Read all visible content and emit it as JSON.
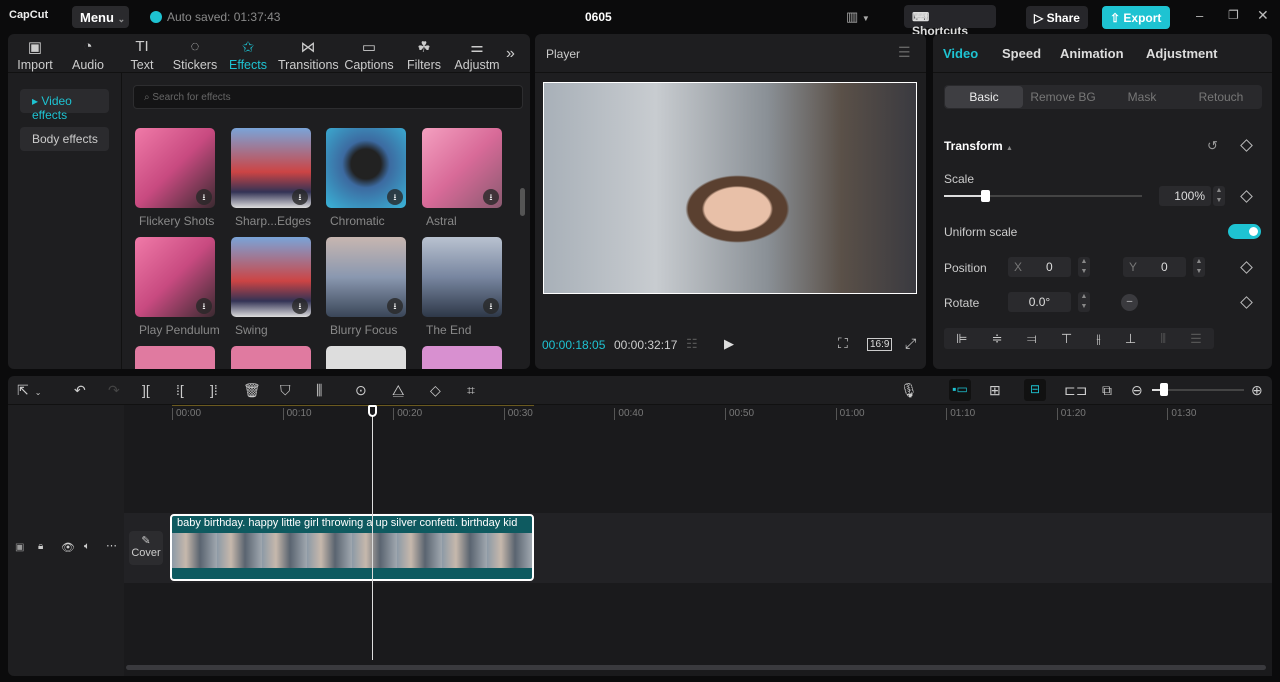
{
  "app": {
    "logo": "CapCut",
    "menu": "Menu",
    "autosave": "Auto saved: 01:37:43",
    "project_title": "0605",
    "shortcuts": "Shortcuts",
    "share": "Share",
    "export": "Export",
    "accent": "#1ec3d2"
  },
  "toolbar": [
    {
      "label": "Import",
      "icon": "import-icon"
    },
    {
      "label": "Audio",
      "icon": "audio-icon"
    },
    {
      "label": "Text",
      "icon": "text-icon"
    },
    {
      "label": "Stickers",
      "icon": "stickers-icon"
    },
    {
      "label": "Effects",
      "icon": "effects-icon",
      "active": true
    },
    {
      "label": "Transitions",
      "icon": "transitions-icon"
    },
    {
      "label": "Captions",
      "icon": "captions-icon"
    },
    {
      "label": "Filters",
      "icon": "filters-icon"
    },
    {
      "label": "Adjustm",
      "icon": "adjustment-icon"
    }
  ],
  "effects": {
    "categories": [
      "Video effects",
      "Body effects"
    ],
    "search_placeholder": "Search for effects",
    "items": [
      "Flickery Shots",
      "Sharp...Edges",
      "Chromatic",
      "Astral",
      "Play Pendulum",
      "Swing",
      "Blurry Focus",
      "The End"
    ]
  },
  "player": {
    "title": "Player",
    "current_time": "00:00:18:05",
    "total_time": "00:00:32:17",
    "ratio": "16:9"
  },
  "inspector": {
    "tabs": [
      "Video",
      "Speed",
      "Animation",
      "Adjustment"
    ],
    "subtabs": [
      "Basic",
      "Remove BG",
      "Mask",
      "Retouch"
    ],
    "transform": "Transform",
    "scale_label": "Scale",
    "scale_value": "100%",
    "scale_fraction": 0.2,
    "uniform_scale": "Uniform scale",
    "uniform_scale_on": true,
    "position_label": "Position",
    "x_label": "X",
    "x_value": "0",
    "y_label": "Y",
    "y_value": "0",
    "rotate_label": "Rotate",
    "rotate_value": "0.0°"
  },
  "timeline": {
    "ruler": [
      "00:00",
      "00:10",
      "00:20",
      "00:30",
      "00:40",
      "00:50",
      "01:00",
      "01:10",
      "01:20",
      "01:30"
    ],
    "clip_title": "baby birthday. happy little girl throwing a up silver confetti. birthday kid",
    "cover": "Cover",
    "playhead_time": "00:18"
  }
}
